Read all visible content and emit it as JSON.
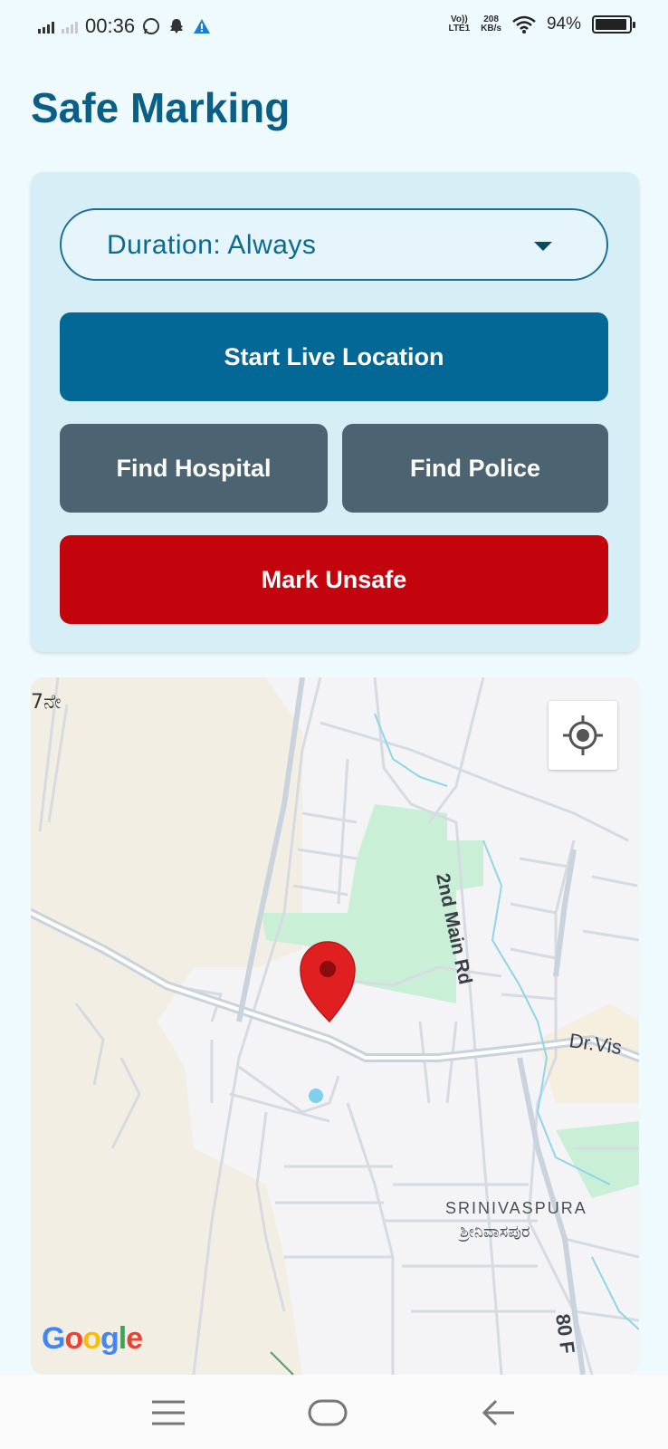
{
  "status_bar": {
    "time": "00:36",
    "network_speed_value": "208",
    "network_speed_unit": "KB/s",
    "volte": "Vo))",
    "lte": "LTE1",
    "battery": "94%",
    "battery_level": 0.94,
    "notification_icons": [
      "whatsapp-icon",
      "snapchat-icon",
      "warning-icon"
    ]
  },
  "page": {
    "title": "Safe Marking"
  },
  "controls": {
    "duration_label": "Duration: Always",
    "start_live_location": "Start Live Location",
    "find_hospital": "Find Hospital",
    "find_police": "Find Police",
    "mark_unsafe": "Mark Unsafe"
  },
  "map": {
    "label_top_left": "7ನೇ",
    "road_label_main": "2nd Main Rd",
    "road_label_dr": "Dr.Vis",
    "area_label_en": "SRINIVASPURA",
    "area_label_kn": "ಶ್ರೀನಿವಾಸಪುರ",
    "road_label_80": "80 F",
    "attribution": [
      "G",
      "o",
      "o",
      "g",
      "l",
      "e"
    ],
    "attribution_colors": [
      "#4285F4",
      "#EA4335",
      "#FBBC05",
      "#4285F4",
      "#34A853",
      "#EA4335"
    ],
    "marker_color": "#e02020"
  },
  "nav_bar": {
    "icons": [
      "menu-icon",
      "home-icon",
      "back-icon"
    ]
  }
}
